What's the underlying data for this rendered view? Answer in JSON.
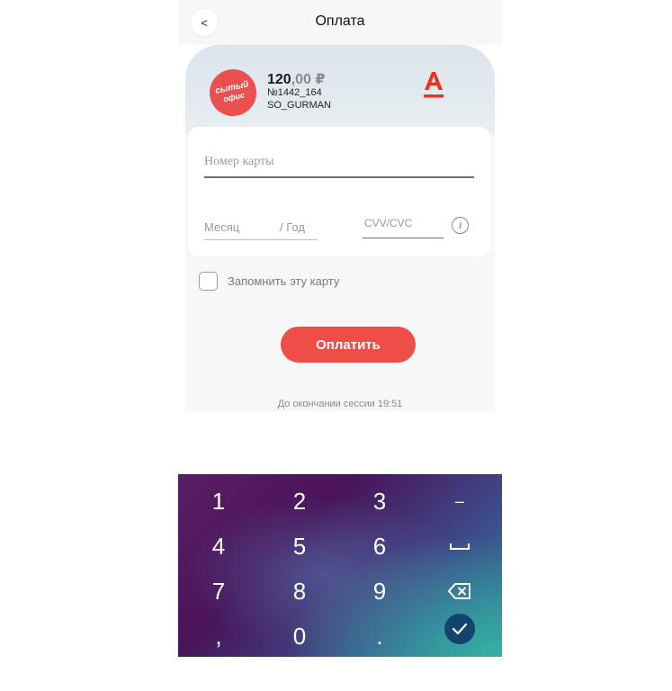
{
  "header": {
    "back_label": "<",
    "title": "Оплата"
  },
  "merchant": {
    "logo_line1": "сытый",
    "logo_line2": "офис",
    "amount_whole": "120",
    "amount_cents": ",00",
    "currency": "₽",
    "order_no": "№1442_164",
    "name": "SO_GURMAN"
  },
  "bank": {
    "logo_letter": "А"
  },
  "form": {
    "card_number_placeholder": "Номер карты",
    "month_placeholder": "Месяц",
    "year_placeholder": "/ Год",
    "cvv_placeholder": "CVV/CVC",
    "info_label": "i",
    "remember_label": "Запомнить эту карту",
    "pay_button_label": "Оплатить",
    "session_text": "До окончании сессии 19:51"
  },
  "keyboard": {
    "keys": [
      "1",
      "2",
      "3",
      "–",
      "4",
      "5",
      "6",
      "␣",
      "7",
      "8",
      "9",
      "⌫",
      ",",
      "0",
      ".",
      "✓"
    ]
  },
  "colors": {
    "accent": "#ef4d48",
    "bank_red": "#ef3124",
    "keyboard_enter": "#13436f"
  }
}
